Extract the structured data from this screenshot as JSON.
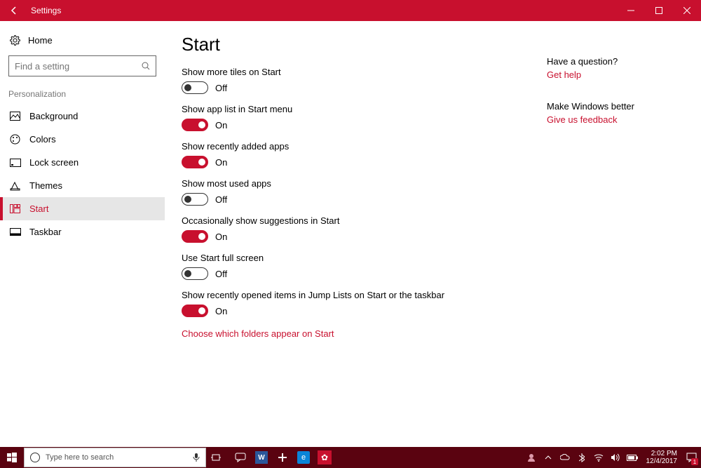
{
  "theme": {
    "accent": "#c8102e"
  },
  "title_bar": {
    "app_name": "Settings"
  },
  "sidebar": {
    "home_label": "Home",
    "search_placeholder": "Find a setting",
    "section_label": "Personalization",
    "items": [
      {
        "icon": "picture-icon",
        "label": "Background"
      },
      {
        "icon": "palette-icon",
        "label": "Colors"
      },
      {
        "icon": "lockscreen-icon",
        "label": "Lock screen"
      },
      {
        "icon": "themes-icon",
        "label": "Themes"
      },
      {
        "icon": "start-icon",
        "label": "Start",
        "active": true
      },
      {
        "icon": "taskbar-icon",
        "label": "Taskbar"
      }
    ]
  },
  "main": {
    "page_title": "Start",
    "settings": [
      {
        "label": "Show more tiles on Start",
        "on": false,
        "state_text": "Off"
      },
      {
        "label": "Show app list in Start menu",
        "on": true,
        "state_text": "On"
      },
      {
        "label": "Show recently added apps",
        "on": true,
        "state_text": "On"
      },
      {
        "label": "Show most used apps",
        "on": false,
        "state_text": "Off"
      },
      {
        "label": "Occasionally show suggestions in Start",
        "on": true,
        "state_text": "On"
      },
      {
        "label": "Use Start full screen",
        "on": false,
        "state_text": "Off"
      },
      {
        "label": "Show recently opened items in Jump Lists on Start or the taskbar",
        "on": true,
        "state_text": "On"
      }
    ],
    "link": "Choose which folders appear on Start"
  },
  "right": {
    "q_head": "Have a question?",
    "q_link": "Get help",
    "fb_head": "Make Windows better",
    "fb_link": "Give us feedback"
  },
  "taskbar": {
    "search_placeholder": "Type here to search",
    "time": "2:02 PM",
    "date": "12/4/2017",
    "action_center_count": "1"
  }
}
